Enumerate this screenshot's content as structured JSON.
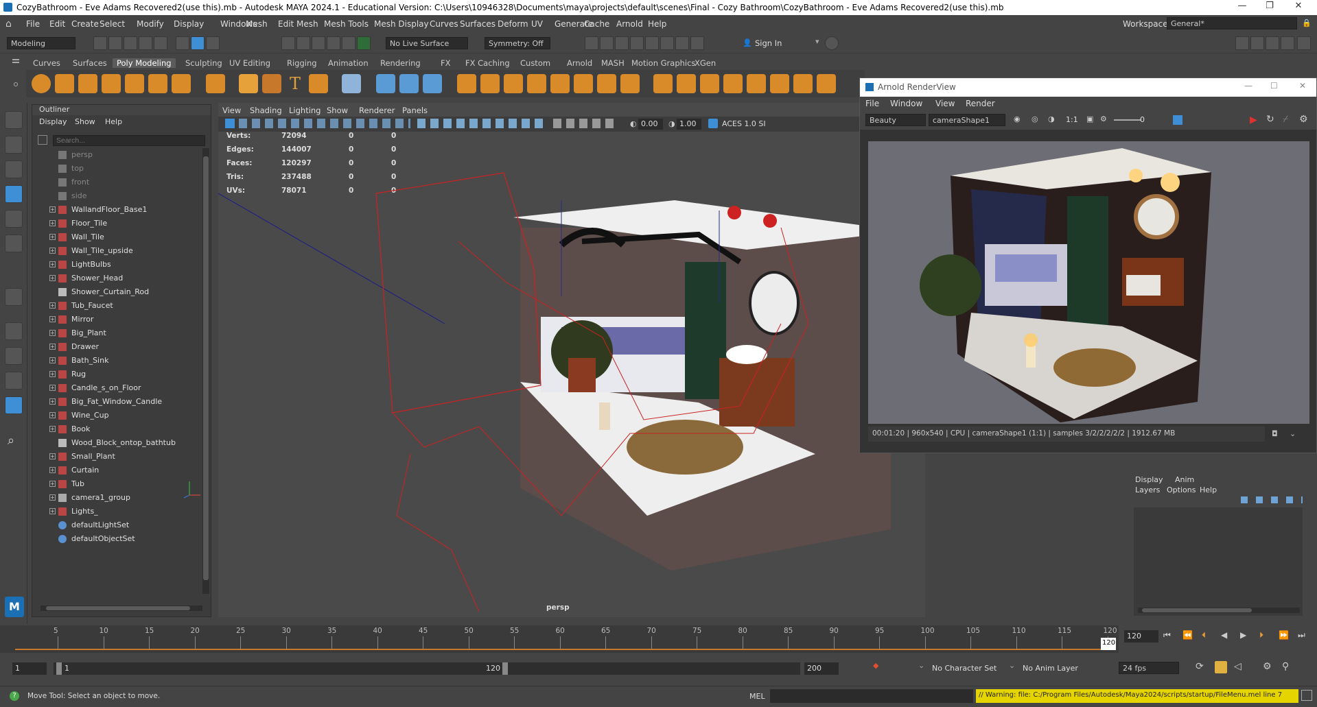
{
  "window": {
    "title": "CozyBathroom - Eve Adams Recovered2(use this).mb - Autodesk MAYA 2024.1 - Educational Version: C:\\Users\\10946328\\Documents\\maya\\projects\\default\\scenes\\Final - Cozy Bathroom\\CozyBathroom - Eve Adams Recovered2(use this).mb",
    "minimize": "—",
    "maximize": "❐",
    "close": "✕"
  },
  "menu": [
    "File",
    "Edit",
    "Create",
    "Select",
    "Modify",
    "Display",
    "Windows",
    "Mesh",
    "Edit Mesh",
    "Mesh Tools",
    "Mesh Display",
    "Curves",
    "Surfaces",
    "Deform",
    "UV",
    "Generate",
    "Cache",
    "Arnold",
    "Help"
  ],
  "workspace": {
    "label": "Workspace:",
    "value": "General*"
  },
  "statusline": {
    "mode": "Modeling",
    "live_surface": "No Live Surface",
    "symmetry": "Symmetry: Off",
    "sign_in": "Sign In"
  },
  "shelf_tabs": [
    "Curves",
    "Surfaces",
    "Poly Modeling",
    "Sculpting",
    "UV Editing",
    "Rigging",
    "Animation",
    "Rendering",
    "FX",
    "FX Caching",
    "Custom",
    "Arnold",
    "MASH",
    "Motion Graphics",
    "XGen"
  ],
  "shelf_active": "Poly Modeling",
  "outliner": {
    "title": "Outliner",
    "menu": [
      "Display",
      "Show",
      "Help"
    ],
    "search_placeholder": "Search...",
    "items": [
      {
        "label": "persp",
        "type": "camera"
      },
      {
        "label": "top",
        "type": "camera"
      },
      {
        "label": "front",
        "type": "camera"
      },
      {
        "label": "side",
        "type": "camera"
      },
      {
        "label": "WallandFloor_Base1",
        "type": "mesh"
      },
      {
        "label": "Floor_Tile",
        "type": "mesh"
      },
      {
        "label": "Wall_Tile",
        "type": "mesh"
      },
      {
        "label": "Wall_Tile_upside",
        "type": "mesh"
      },
      {
        "label": "LightBulbs",
        "type": "mesh"
      },
      {
        "label": "Shower_Head",
        "type": "mesh"
      },
      {
        "label": "Shower_Curtain_Rod",
        "type": "curve"
      },
      {
        "label": "Tub_Faucet",
        "type": "mesh"
      },
      {
        "label": "Mirror",
        "type": "mesh"
      },
      {
        "label": "Big_Plant",
        "type": "mesh"
      },
      {
        "label": "Drawer",
        "type": "mesh"
      },
      {
        "label": "Bath_Sink",
        "type": "mesh"
      },
      {
        "label": "Rug",
        "type": "mesh"
      },
      {
        "label": "Candle_s_on_Floor",
        "type": "mesh"
      },
      {
        "label": "Big_Fat_Window_Candle",
        "type": "mesh"
      },
      {
        "label": "Wine_Cup",
        "type": "mesh"
      },
      {
        "label": "Book",
        "type": "mesh"
      },
      {
        "label": "Wood_Block_ontop_bathtub",
        "type": "curve"
      },
      {
        "label": "Small_Plant",
        "type": "mesh"
      },
      {
        "label": "Curtain",
        "type": "mesh"
      },
      {
        "label": "Tub",
        "type": "mesh"
      },
      {
        "label": "camera1_group",
        "type": "group"
      },
      {
        "label": "Lights_",
        "type": "mesh"
      },
      {
        "label": "defaultLightSet",
        "type": "set"
      },
      {
        "label": "defaultObjectSet",
        "type": "set"
      }
    ]
  },
  "viewport": {
    "menu": [
      "View",
      "Shading",
      "Lighting",
      "Show",
      "Renderer",
      "Panels"
    ],
    "exposure": "0.00",
    "gamma": "1.00",
    "color_space": "ACES 1.0 SI",
    "camera_label": "persp",
    "stats": [
      {
        "label": "Verts:",
        "a": "72094",
        "b": "0",
        "c": "0"
      },
      {
        "label": "Edges:",
        "a": "144007",
        "b": "0",
        "c": "0"
      },
      {
        "label": "Faces:",
        "a": "120297",
        "b": "0",
        "c": "0"
      },
      {
        "label": "Tris:",
        "a": "237488",
        "b": "0",
        "c": "0"
      },
      {
        "label": "UVs:",
        "a": "78071",
        "b": "0",
        "c": "0"
      }
    ]
  },
  "renderview": {
    "title": "Arnold RenderView",
    "menu": [
      "File",
      "Window",
      "View",
      "Render"
    ],
    "aov": "Beauty",
    "camera": "cameraShape1",
    "ratio": "1:1",
    "exposure": "0",
    "status": "00:01:20 | 960x540 | CPU | cameraShape1 (1:1) | samples 3/2/2/2/2/2 | 1912.67 MB"
  },
  "layers": {
    "tabs": [
      "Display",
      "Anim"
    ],
    "menu": [
      "Layers",
      "Options",
      "Help"
    ]
  },
  "timeline": {
    "ticks": [
      "5",
      "10",
      "15",
      "20",
      "25",
      "30",
      "35",
      "40",
      "45",
      "50",
      "55",
      "60",
      "65",
      "70",
      "75",
      "80",
      "85",
      "90",
      "95",
      "100",
      "105",
      "110",
      "115",
      "120"
    ],
    "current_frame": "120",
    "end_marker": "120"
  },
  "range": {
    "start": "1",
    "inner_start": "1",
    "inner_end": "120",
    "end": "200",
    "character_set": "No Character Set",
    "anim_layer": "No Anim Layer",
    "fps": "24 fps"
  },
  "help": {
    "text": "Move Tool: Select an object to move.",
    "mel_label": "MEL",
    "warning": "// Warning: file: C:/Program Files/Autodesk/Maya2024/scripts/startup/FileMenu.mel line 7"
  }
}
